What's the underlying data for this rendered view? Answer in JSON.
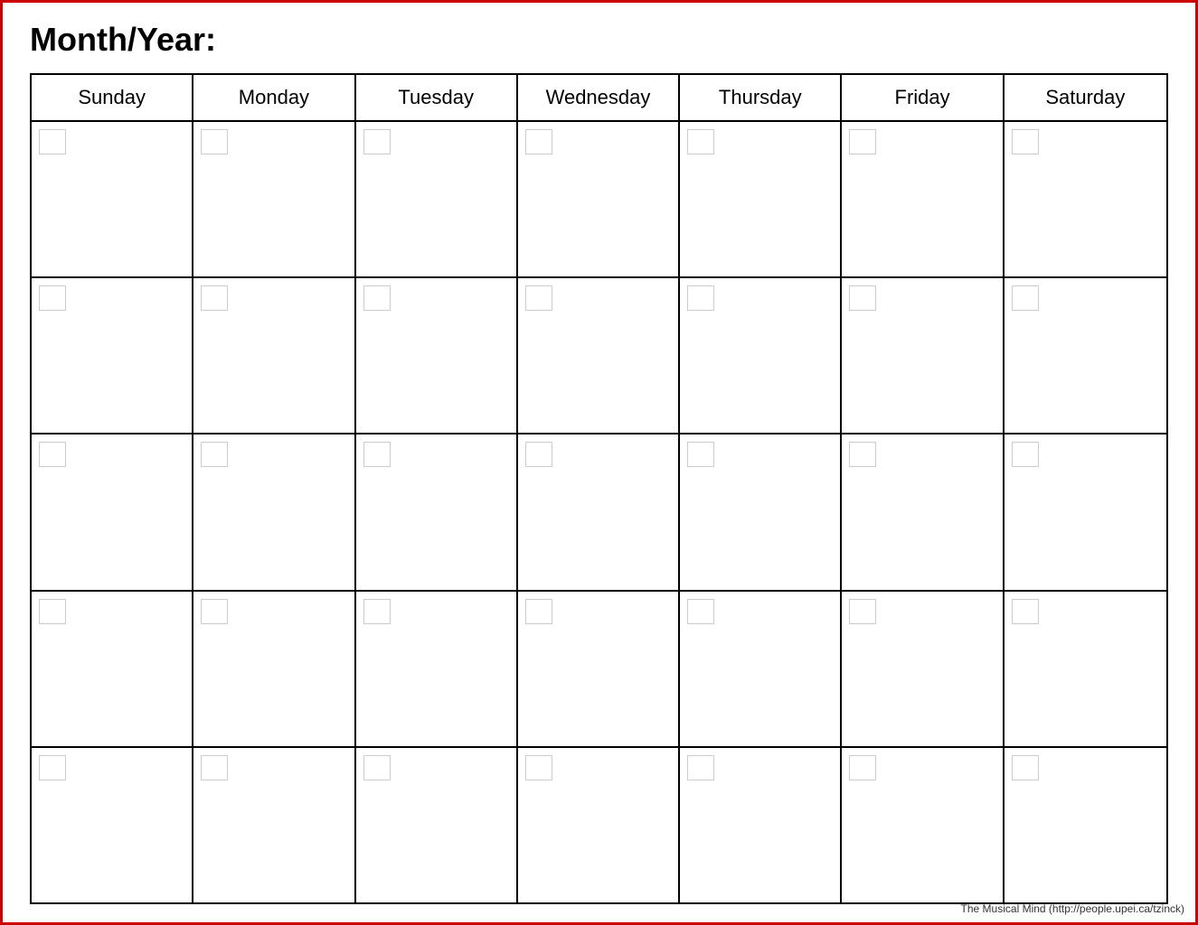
{
  "header": {
    "title": "Month/Year:"
  },
  "calendar": {
    "days": [
      "Sunday",
      "Monday",
      "Tuesday",
      "Wednesday",
      "Thursday",
      "Friday",
      "Saturday"
    ],
    "rows": 5
  },
  "footer": {
    "text": "The Musical Mind  (http://people.upei.ca/tzinck)"
  }
}
